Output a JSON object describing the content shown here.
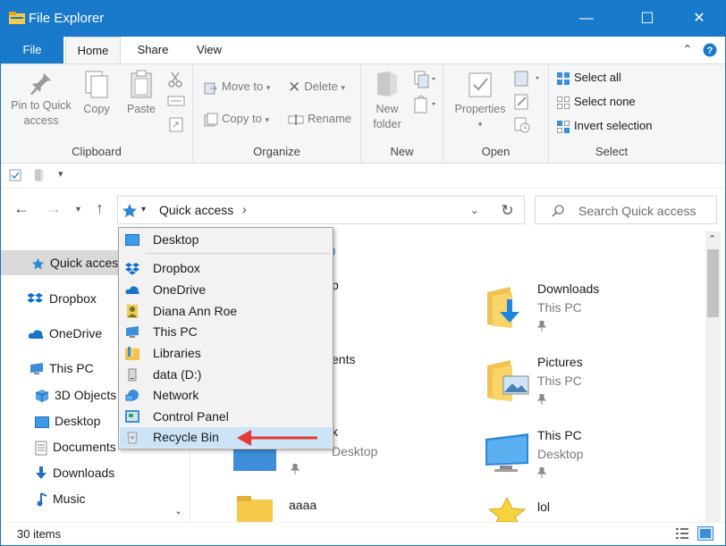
{
  "window": {
    "title": "File Explorer",
    "controls": {
      "minimize": "—",
      "maximize": "☐",
      "close": "✕"
    }
  },
  "ribbon_tabs": [
    "File",
    "Home",
    "Share",
    "View"
  ],
  "ribbon": {
    "clipboard": {
      "label": "Clipboard",
      "pin_label_1": "Pin to Quick",
      "pin_label_2": "access",
      "copy": "Copy",
      "paste": "Paste"
    },
    "organize": {
      "label": "Organize",
      "move_to": "Move to",
      "copy_to": "Copy to",
      "delete": "Delete",
      "rename": "Rename"
    },
    "new": {
      "label": "New",
      "new_folder_1": "New",
      "new_folder_2": "folder"
    },
    "open": {
      "label": "Open",
      "properties": "Properties"
    },
    "select": {
      "label": "Select",
      "select_all": "Select all",
      "select_none": "Select none",
      "invert_selection": "Invert selection"
    }
  },
  "address": {
    "path": "Quick access",
    "search_placeholder": "Search Quick access"
  },
  "nav_pane": {
    "items": [
      {
        "label": "Quick access",
        "icon": "star-icon"
      },
      {
        "label": "Dropbox",
        "icon": "dropbox-icon"
      },
      {
        "label": "OneDrive",
        "icon": "onedrive-icon"
      },
      {
        "label": "This PC",
        "icon": "pc-icon"
      },
      {
        "label": "3D Objects",
        "icon": "cube-icon"
      },
      {
        "label": "Desktop",
        "icon": "desktop-icon"
      },
      {
        "label": "Documents",
        "icon": "document-icon"
      },
      {
        "label": "Downloads",
        "icon": "download-icon"
      },
      {
        "label": "Music",
        "icon": "music-icon"
      }
    ]
  },
  "dropdown": {
    "items": [
      {
        "label": "Desktop",
        "icon": "desktop-icon"
      },
      {
        "label": "Dropbox",
        "icon": "dropbox-icon"
      },
      {
        "label": "OneDrive",
        "icon": "onedrive-icon"
      },
      {
        "label": "Diana Ann Roe",
        "icon": "user-icon"
      },
      {
        "label": "This PC",
        "icon": "pc-icon"
      },
      {
        "label": "Libraries",
        "icon": "libraries-icon"
      },
      {
        "label": "data (D:)",
        "icon": "drive-icon"
      },
      {
        "label": "Network",
        "icon": "network-icon"
      },
      {
        "label": "Control Panel",
        "icon": "control-panel-icon"
      },
      {
        "label": "Recycle Bin",
        "icon": "recycle-bin-icon"
      }
    ]
  },
  "content": {
    "group_header_fragment": ")",
    "tiles": [
      {
        "name": "Downloads",
        "sub": "This PC",
        "icon": "downloads-folder-icon"
      },
      {
        "name": "Pictures",
        "sub": "This PC",
        "icon": "pictures-folder-icon"
      },
      {
        "name": "This PC",
        "sub": "Desktop",
        "icon": "pc-icon"
      },
      {
        "name": "lol",
        "sub": "",
        "icon": "star-folder-icon"
      },
      {
        "name": "aaaa",
        "sub": "",
        "icon": "folder-icon"
      }
    ],
    "partial_texts": [
      "p",
      "ents",
      "k",
      "Desktop"
    ]
  },
  "status": {
    "items_count": "30 items"
  },
  "colors": {
    "accent": "#1979ca",
    "highlight": "#cce4f7",
    "arrow": "#e53935",
    "folder": "#f7c948"
  }
}
